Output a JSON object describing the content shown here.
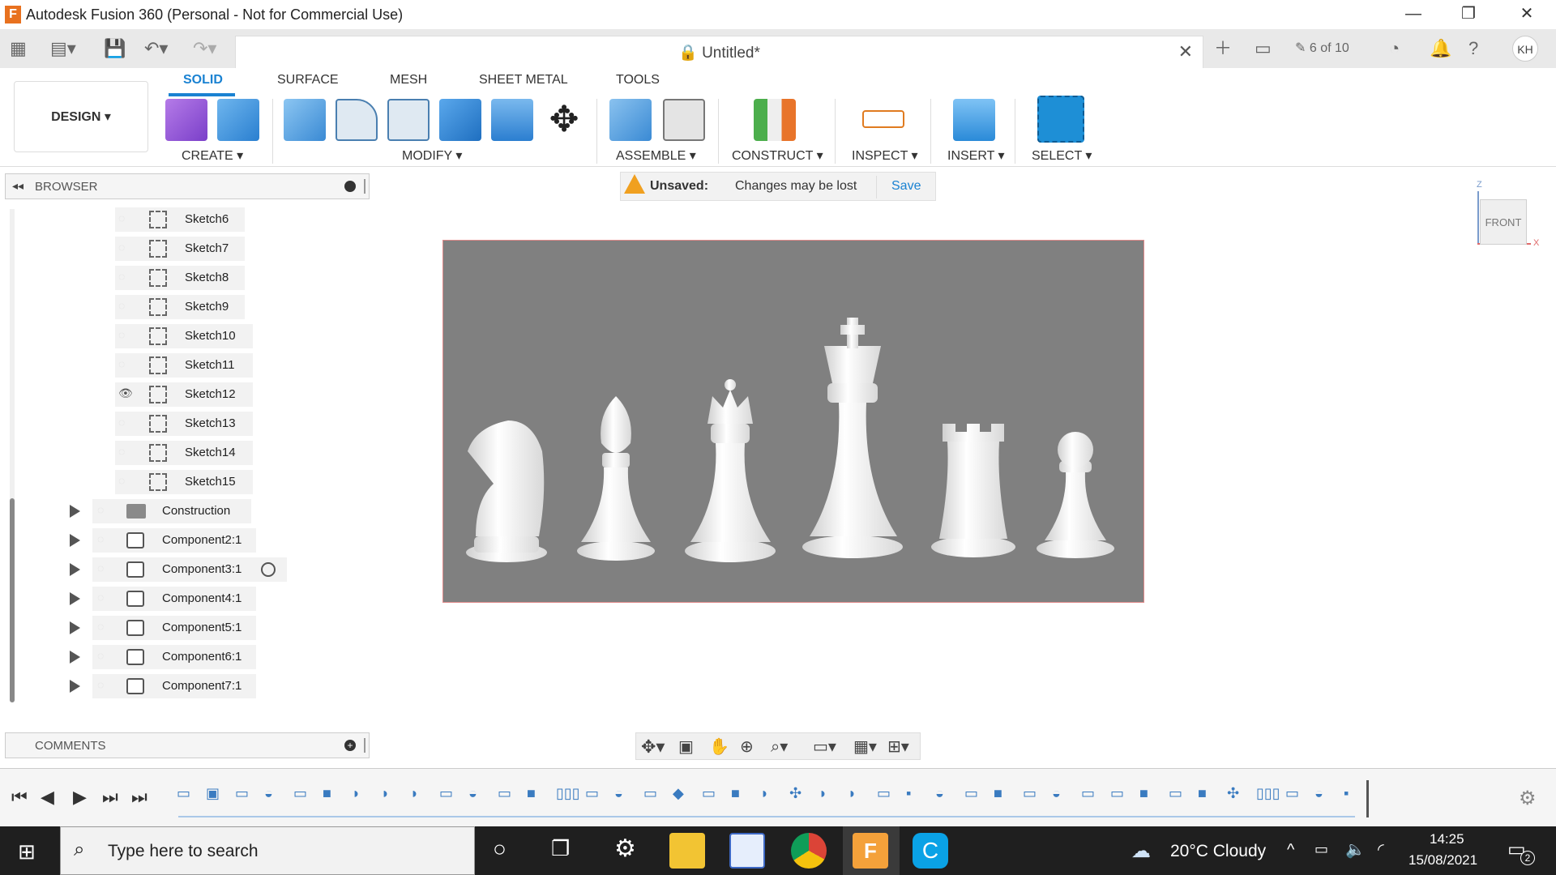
{
  "window": {
    "title": "Autodesk Fusion 360 (Personal - Not for Commercial Use)",
    "logo": "F"
  },
  "quickbar": {
    "doc_title": "Untitled*",
    "jobs": "6 of 10",
    "user": "KH"
  },
  "ribbon": {
    "tabs": [
      "SOLID",
      "SURFACE",
      "MESH",
      "SHEET METAL",
      "TOOLS"
    ],
    "workspace": "DESIGN ▾",
    "groups": [
      "CREATE ▾",
      "MODIFY ▾",
      "ASSEMBLE ▾",
      "CONSTRUCT ▾",
      "INSPECT ▾",
      "INSERT ▾",
      "SELECT ▾"
    ]
  },
  "browser": {
    "title": "BROWSER",
    "sketches": [
      "Sketch6",
      "Sketch7",
      "Sketch8",
      "Sketch9",
      "Sketch10",
      "Sketch11",
      "Sketch12",
      "Sketch13",
      "Sketch14",
      "Sketch15"
    ],
    "folders": [
      "Construction"
    ],
    "components": [
      "Component2:1",
      "Component3:1",
      "Component4:1",
      "Component5:1",
      "Component6:1",
      "Component7:1"
    ]
  },
  "banner": {
    "label": "Unsaved:",
    "message": "Changes may be lost",
    "action": "Save"
  },
  "viewcube": {
    "face": "FRONT",
    "axis_z": "Z",
    "axis_x": "X"
  },
  "comments": {
    "title": "COMMENTS"
  },
  "taskbar": {
    "search_placeholder": "Type here to search",
    "weather": "20°C  Cloudy",
    "time": "14:25",
    "date": "15/08/2021",
    "notifications": "2"
  },
  "colors": {
    "accent": "#1a82d2",
    "viewport_bg": "#808080",
    "taskbar": "#1f1f1f"
  }
}
